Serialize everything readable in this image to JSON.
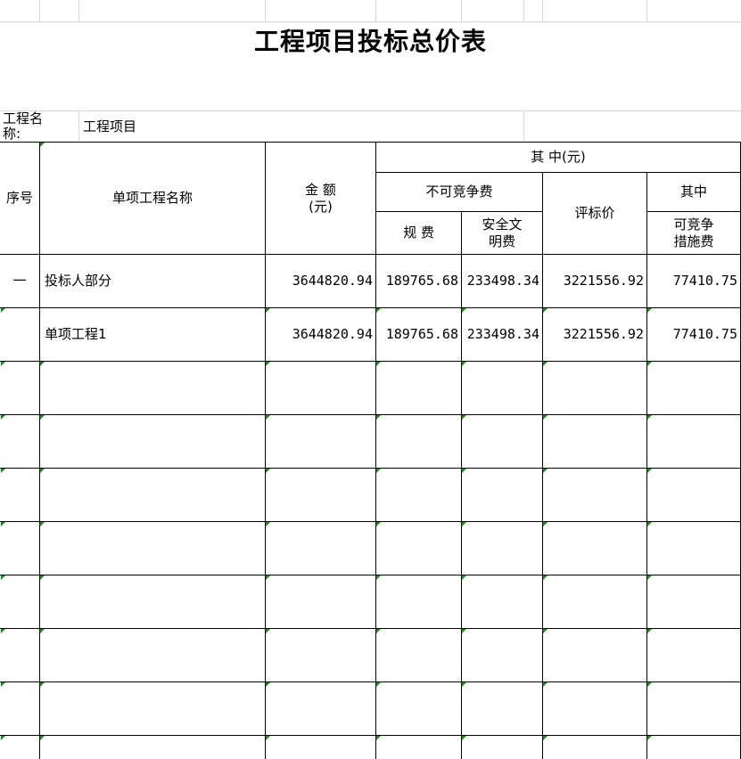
{
  "title": "工程项目投标总价表",
  "project": {
    "label": "工程名称:",
    "value": "工程项目"
  },
  "header": {
    "seq": "序号",
    "name": "单项工程名称",
    "amount": "金 额\n(元)",
    "of_which": "其 中(元)",
    "non_competitive": "不可竞争费",
    "regulatory_fee": "规 费",
    "safety_fee": "安全文\n明费",
    "bid_eval_price": "评标价",
    "of_which2": "其中",
    "competitive_measures": "可竞争\n措施费"
  },
  "rows": [
    {
      "seq": "一",
      "name": "投标人部分",
      "amount": "3644820.94",
      "regulatory_fee": "189765.68",
      "safety_fee": "233498.34",
      "bid_eval_price": "3221556.92",
      "competitive_measures": "77410.75"
    },
    {
      "seq": "",
      "name": "单项工程1",
      "amount": "3644820.94",
      "regulatory_fee": "189765.68",
      "safety_fee": "233498.34",
      "bid_eval_price": "3221556.92",
      "competitive_measures": "77410.75"
    }
  ],
  "colors": {
    "gridline": "#d9d9d9",
    "border": "#000000",
    "error_marker": "#1a8c1a"
  }
}
